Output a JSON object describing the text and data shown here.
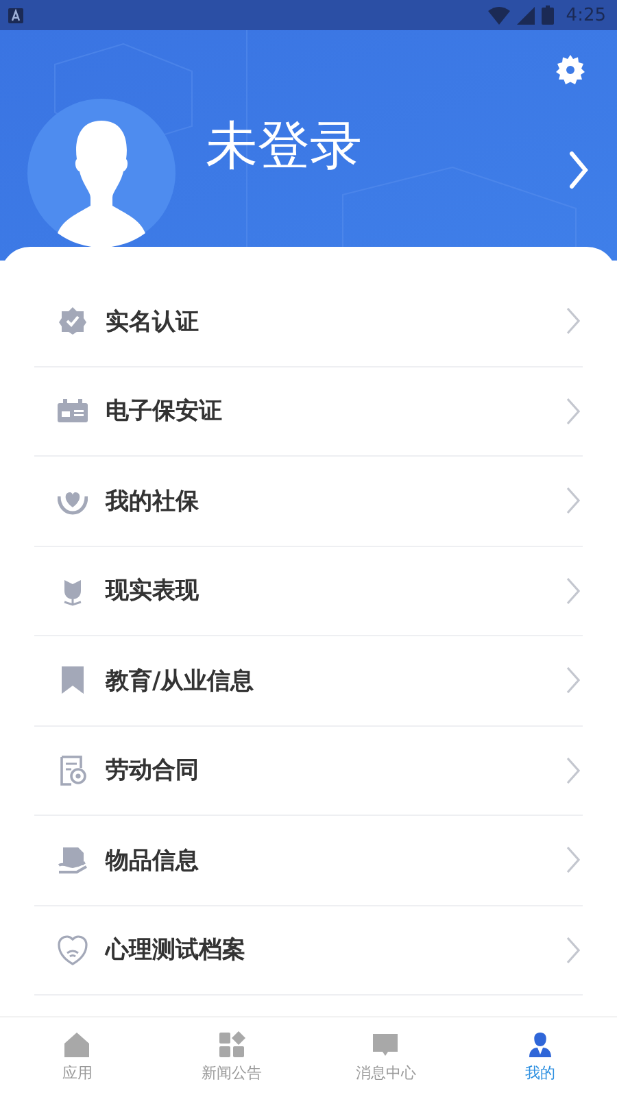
{
  "status_bar": {
    "time": "4:25"
  },
  "profile": {
    "name": "未登录"
  },
  "menu": [
    {
      "label": "实名认证"
    },
    {
      "label": "电子保安证"
    },
    {
      "label": "我的社保"
    },
    {
      "label": "现实表现"
    },
    {
      "label": "教育/从业信息"
    },
    {
      "label": "劳动合同"
    },
    {
      "label": "物品信息"
    },
    {
      "label": "心理测试档案"
    }
  ],
  "tabs": [
    {
      "label": "应用",
      "selected": false
    },
    {
      "label": "新闻公告",
      "selected": false
    },
    {
      "label": "消息中心",
      "selected": false
    },
    {
      "label": "我的",
      "selected": true
    }
  ]
}
